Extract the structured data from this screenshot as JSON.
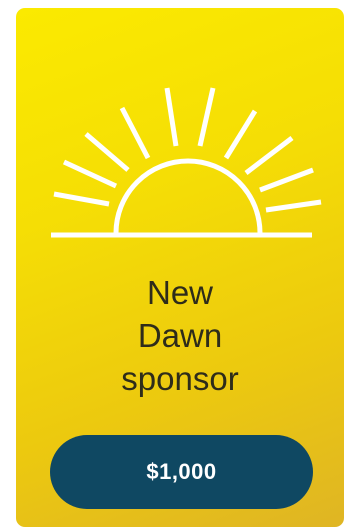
{
  "card": {
    "icon": "rising-sun-icon",
    "title_lines": [
      "New",
      "Dawn",
      "sponsor"
    ],
    "price_label": "$1,000"
  },
  "colors": {
    "card_gradient_top": "#fbea00",
    "card_gradient_bottom": "#dfb524",
    "button_background": "#0f4862",
    "button_text": "#ffffff",
    "sun_stroke": "#ffffff",
    "title_text": "#2e2c1a"
  }
}
